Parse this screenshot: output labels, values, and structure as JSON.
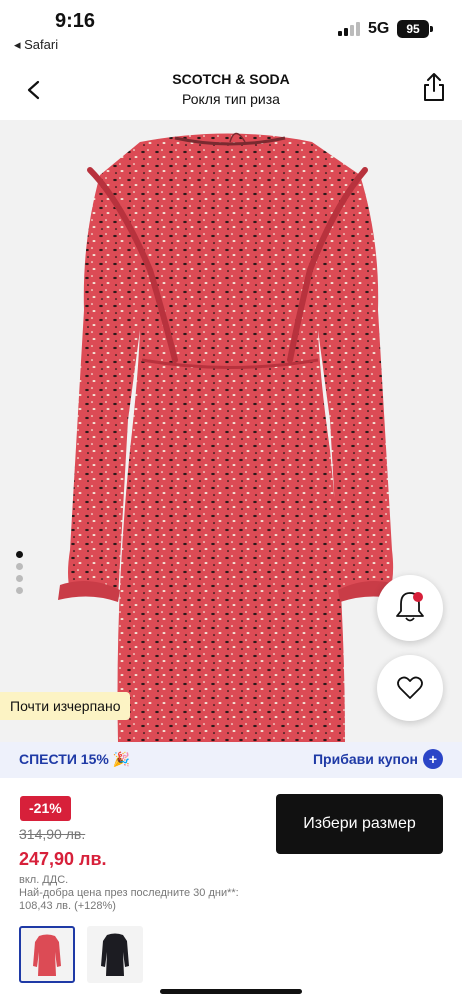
{
  "status_bar": {
    "time": "9:16",
    "back_app": "Safari",
    "network": "5G",
    "battery": "95"
  },
  "header": {
    "brand": "SCOTCH & SODA",
    "subtitle": "Рокля тип риза"
  },
  "gallery": {
    "page_count": 4,
    "active_index": 0
  },
  "stock_badge": "Почти изчерпано",
  "promo": {
    "left": "СПЕСТИ 15% 🎉",
    "right": "Прибави купон",
    "plus": "+"
  },
  "price": {
    "discount": "-21%",
    "old": "314,90 лв.",
    "new": "247,90 лв.",
    "vat": "вкл. ДДС.",
    "best_label": "Най-добра цена през последните 30 дни**:",
    "best_value": "108,43 лв. (+128%)"
  },
  "select_size": "Избери размер",
  "colors": {
    "accent": "#1f3aa6",
    "sale": "#d7203a",
    "dress": "#dc4b55"
  },
  "icons": [
    "back-icon",
    "share-icon",
    "bell-icon",
    "heart-icon",
    "plus-icon"
  ]
}
